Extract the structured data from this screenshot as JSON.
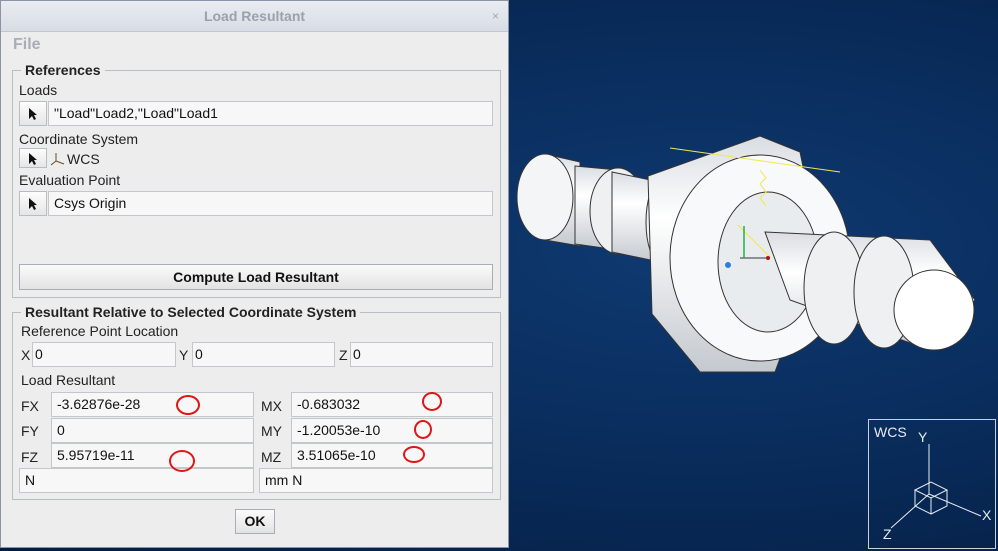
{
  "dialog": {
    "title": "Load Resultant",
    "close": "×",
    "menu_file": "File",
    "references": {
      "legend": "References",
      "loads_label": "Loads",
      "loads_value": "\"Load\"Load2,\"Load\"Load1",
      "csys_label": "Coordinate System",
      "csys_value": "WCS",
      "eval_label": "Evaluation Point",
      "eval_value": "Csys Origin",
      "compute_button": "Compute Load Resultant"
    },
    "resultant": {
      "legend": "Resultant Relative to Selected Coordinate System",
      "ref_point_label": "Reference Point Location",
      "x_label": "X",
      "x_value": "0",
      "y_label": "Y",
      "y_value": "0",
      "z_label": "Z",
      "z_value": "0",
      "load_label": "Load Resultant",
      "fx_label": "FX",
      "fx_value": "-3.62876e-28",
      "fy_label": "FY",
      "fy_value": "0",
      "fz_label": "FZ",
      "fz_value": "5.95719e-11",
      "mx_label": "MX",
      "mx_value": "-0.683032",
      "my_label": "MY",
      "my_value": "-1.20053e-10",
      "mz_label": "MZ",
      "mz_value": "3.51065e-10",
      "force_unit": "N",
      "moment_unit": "mm N"
    },
    "ok_button": "OK"
  },
  "triad": {
    "title": "WCS",
    "y": "Y",
    "x": "X",
    "z": "Z"
  },
  "colors": {
    "viewport": "#082a58",
    "annotation": "#e01515",
    "dialog": "#ededed"
  }
}
